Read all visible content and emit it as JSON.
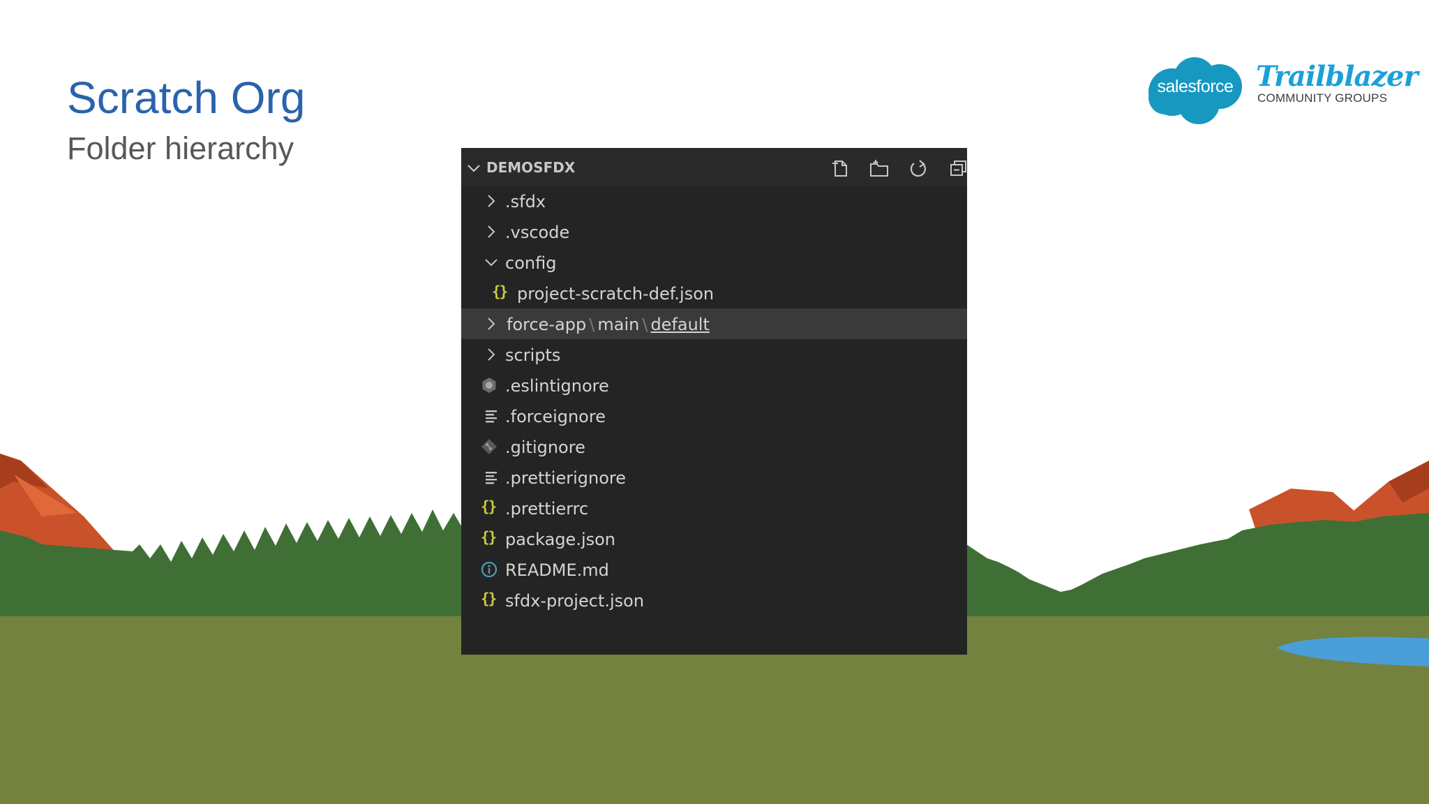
{
  "slide": {
    "title": "Scratch Org",
    "subtitle": "Folder hierarchy"
  },
  "logo": {
    "cloud_text": "salesforce",
    "brand": "Trailblazer",
    "tagline": "COMMUNITY GROUPS"
  },
  "explorer": {
    "section_title": "DEMOSFDX",
    "actions": [
      "new-file-icon",
      "new-folder-icon",
      "refresh-icon",
      "collapse-all-icon"
    ],
    "items": [
      {
        "label": ".sfdx",
        "kind": "folder",
        "expanded": false,
        "depth": 0
      },
      {
        "label": ".vscode",
        "kind": "folder",
        "expanded": false,
        "depth": 0
      },
      {
        "label": "config",
        "kind": "folder",
        "expanded": true,
        "depth": 0
      },
      {
        "label": "project-scratch-def.json",
        "kind": "json",
        "depth": 1
      },
      {
        "label_parts": [
          "force-app",
          "main",
          "default"
        ],
        "separator": "\\",
        "kind": "folder",
        "expanded": false,
        "depth": 0,
        "selected": true
      },
      {
        "label": "scripts",
        "kind": "folder",
        "expanded": false,
        "depth": 0
      },
      {
        "label": ".eslintignore",
        "kind": "eslint",
        "depth": 0
      },
      {
        "label": ".forceignore",
        "kind": "text",
        "depth": 0
      },
      {
        "label": ".gitignore",
        "kind": "git",
        "depth": 0
      },
      {
        "label": ".prettierignore",
        "kind": "text",
        "depth": 0
      },
      {
        "label": ".prettierrc",
        "kind": "json",
        "depth": 0
      },
      {
        "label": "package.json",
        "kind": "json",
        "depth": 0
      },
      {
        "label": "README.md",
        "kind": "info",
        "depth": 0
      },
      {
        "label": "sfdx-project.json",
        "kind": "json",
        "depth": 0
      }
    ],
    "json_icon_glyph": "{}"
  },
  "colors": {
    "title": "#2a63ac",
    "subtitle": "#58585a",
    "panel_bg": "#242424",
    "selected_row": "#3a3a3a",
    "json_icon": "#cbcb41",
    "info_icon": "#519aba",
    "grass": "#73823f",
    "forest": "#3f6f35",
    "mountain": "#c9522a",
    "lake": "#4a9fd8",
    "salesforce_blue": "#1798c1"
  }
}
